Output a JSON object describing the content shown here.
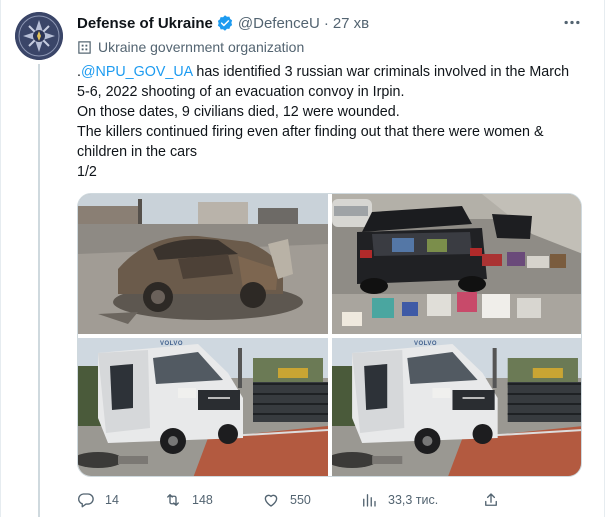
{
  "author": {
    "display_name": "Defense of Ukraine",
    "handle": "@DefenceU",
    "separator": "·",
    "time": "27 хв",
    "verified": true,
    "affiliation": "Ukraine government organization"
  },
  "tweet": {
    "line1_prefix": ".",
    "line1_mention": "@NPU_GOV_UA",
    "line1_rest": " has identified 3 russian war criminals involved in the March",
    "line2": "5-6, 2022 shooting of an evacuation convoy in Irpin.",
    "line3": "On those dates, 9 civilians died, 12 were wounded.",
    "line4": "The killers continued firing even after finding out that there were women &",
    "line5": "children in the cars",
    "line6": "1/2"
  },
  "media": {
    "photos": [
      {
        "icon": "burned-car-photo"
      },
      {
        "icon": "car-trunk-belongings-photo"
      },
      {
        "icon": "white-van-photo"
      },
      {
        "icon": "white-van-photo"
      }
    ],
    "van_brand": "VOLVO"
  },
  "actions": {
    "replies": "14",
    "retweets": "148",
    "likes": "550",
    "views": "33,3 тис."
  },
  "colors": {
    "accent": "#1d9bf0",
    "text": "#0f1419",
    "secondary": "#536471",
    "verified": "#1d9bf0"
  }
}
